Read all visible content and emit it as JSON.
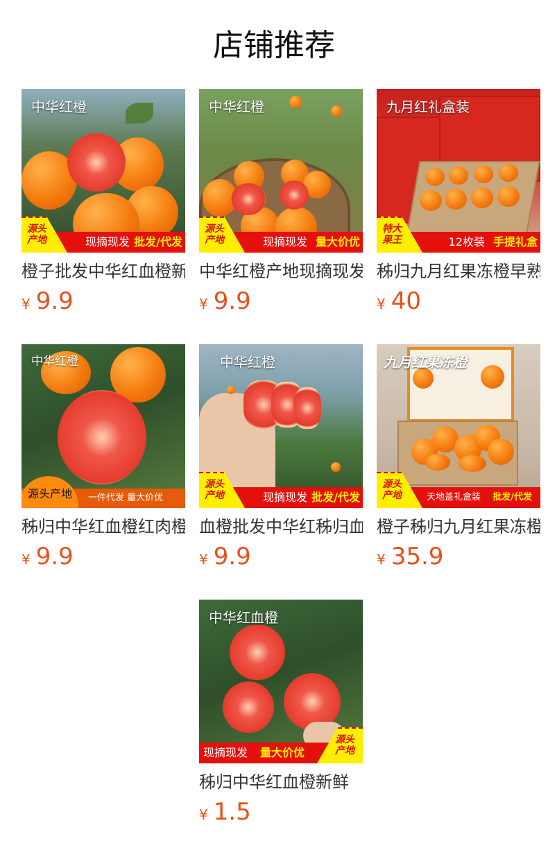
{
  "page_title": "店铺推荐",
  "currency": "¥",
  "products": [
    {
      "caption": "中华红橙",
      "tag": "源头\n产地",
      "ribbon_a": "现摘现发",
      "ribbon_b": "批发/代发",
      "name": "橙子批发中华红血橙新鲜",
      "price": "9.9"
    },
    {
      "caption": "中华红橙",
      "tag": "源头\n产地",
      "ribbon_a": "现摘现发",
      "ribbon_b": "量大价优",
      "name": "中华红橙产地现摘现发",
      "price": "9.9"
    },
    {
      "caption": "九月红礼盒装",
      "tag": "特大\n果王",
      "ribbon_a": "12枚装",
      "ribbon_b": "手提礼盒",
      "name": "秭归九月红果冻橙早熟",
      "price": "40"
    },
    {
      "caption": "中华红橙",
      "bubble": "源头产地",
      "ribbon_a": "一件代发  量大价优",
      "name": "秭归中华红血橙红肉橙子",
      "price": "9.9"
    },
    {
      "caption": "中华红橙",
      "tag": "源头\n产地",
      "ribbon_a": "现摘现发",
      "ribbon_b": "批发/代发",
      "name": "血橙批发中华红秭归血橙",
      "price": "9.9"
    },
    {
      "caption": "九月红果冻橙",
      "tag": "源头\n产地",
      "ribbon_a": "天地盖礼盒装",
      "ribbon_b": "批发/代发",
      "name": "橙子秭归九月红果冻橙",
      "price": "35.9"
    },
    {
      "caption": "中华红血橙",
      "tag": "源头\n产地",
      "ribbon_a": "现摘现发",
      "ribbon_b": "量大价优",
      "name": "秭归中华红血橙新鲜",
      "price": "1.5"
    }
  ]
}
